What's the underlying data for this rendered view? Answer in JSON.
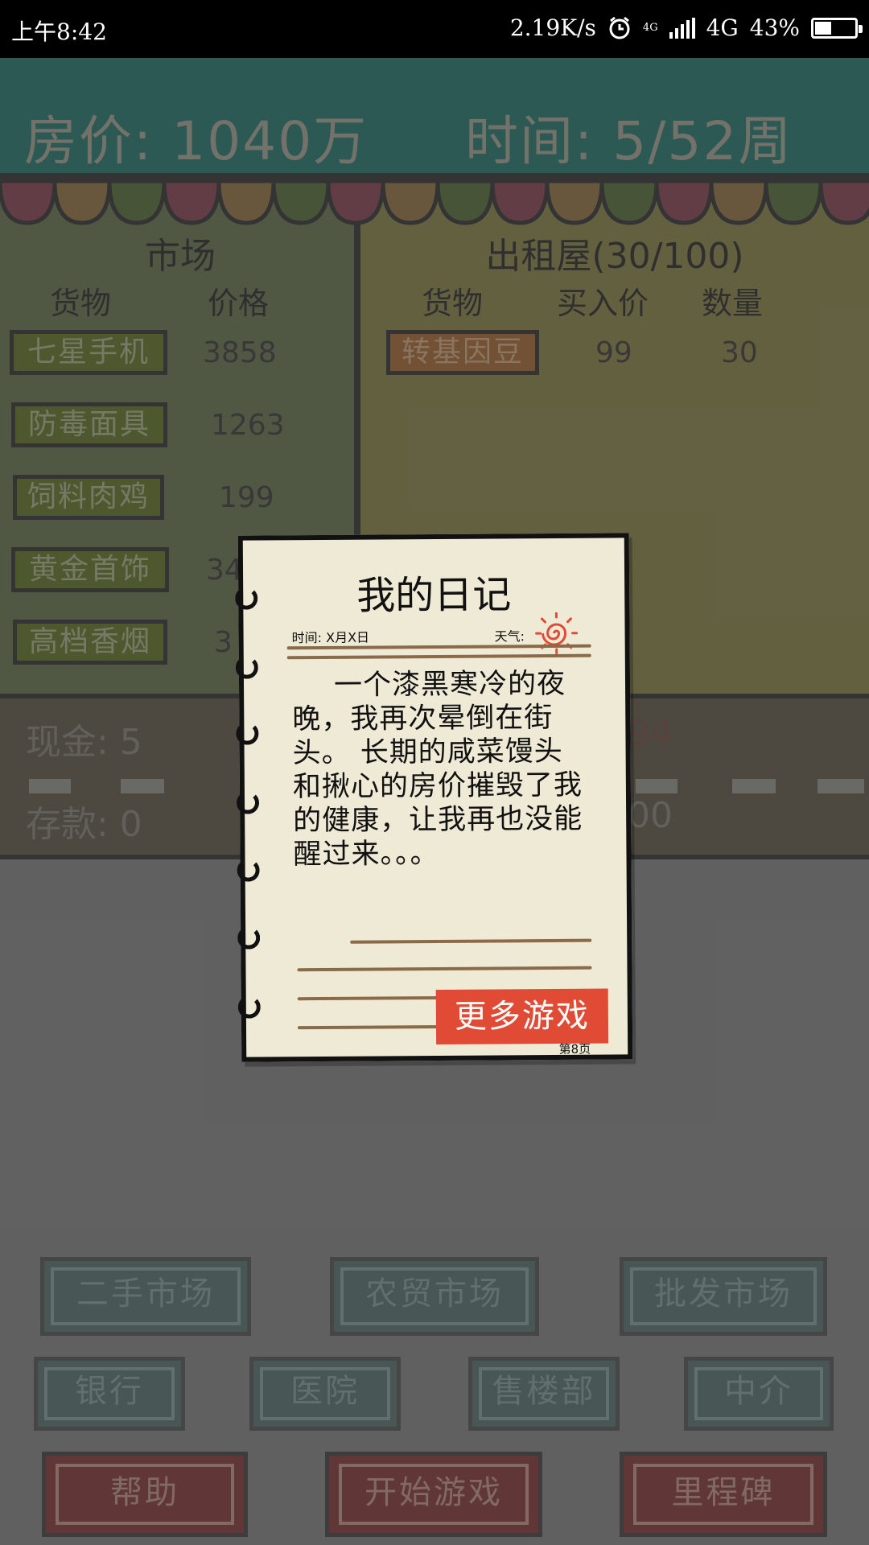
{
  "status_bar": {
    "time": "上午8:42",
    "speed": "2.19K/s",
    "net_small": "4G",
    "network": "4G",
    "battery": "43%",
    "battery_level": 0.43
  },
  "header": {
    "price_label": "房价: 1040万",
    "time_label": "时间: 5/52周"
  },
  "market": {
    "title": "市场",
    "col_goods": "货物",
    "col_price": "价格",
    "items": [
      {
        "name": "七星手机",
        "price": "3858"
      },
      {
        "name": "防毒面具",
        "price": "1263"
      },
      {
        "name": "饲料肉鸡",
        "price": "199"
      },
      {
        "name": "黄金首饰",
        "price": "34"
      },
      {
        "name": "高档香烟",
        "price": "3"
      }
    ]
  },
  "rental": {
    "title": "出租屋(30/100)",
    "col_goods": "货物",
    "col_buy": "买入价",
    "col_qty": "数量",
    "items": [
      {
        "name": "转基因豆",
        "buy": "99",
        "qty": "30"
      }
    ]
  },
  "finance": {
    "cash": "现金: 5",
    "deposit": "存款: 0",
    "right_top": "94",
    "right_bottom": "00"
  },
  "buttons": {
    "row1": [
      "二手市场",
      "农贸市场",
      "批发市场"
    ],
    "row2": [
      "银行",
      "医院",
      "售楼部",
      "中介"
    ],
    "row3": [
      "帮助",
      "开始游戏",
      "里程碑"
    ]
  },
  "diary": {
    "title": "我的日记",
    "time_label": "时间: X月X日",
    "weather_label": "天气:",
    "text": "一个漆黑寒冷的夜晚，我再次晕倒在街头。 长期的咸菜馒头和揪心的房价摧毁了我的健康，让我再也没能醒过来。。。",
    "more_games": "更多游戏",
    "page": "第8页"
  },
  "colors": {
    "header": "#0b5e55",
    "market_panel": "#4e5a36",
    "rental_panel": "#6f6a30",
    "more_games": "#e14b36"
  }
}
